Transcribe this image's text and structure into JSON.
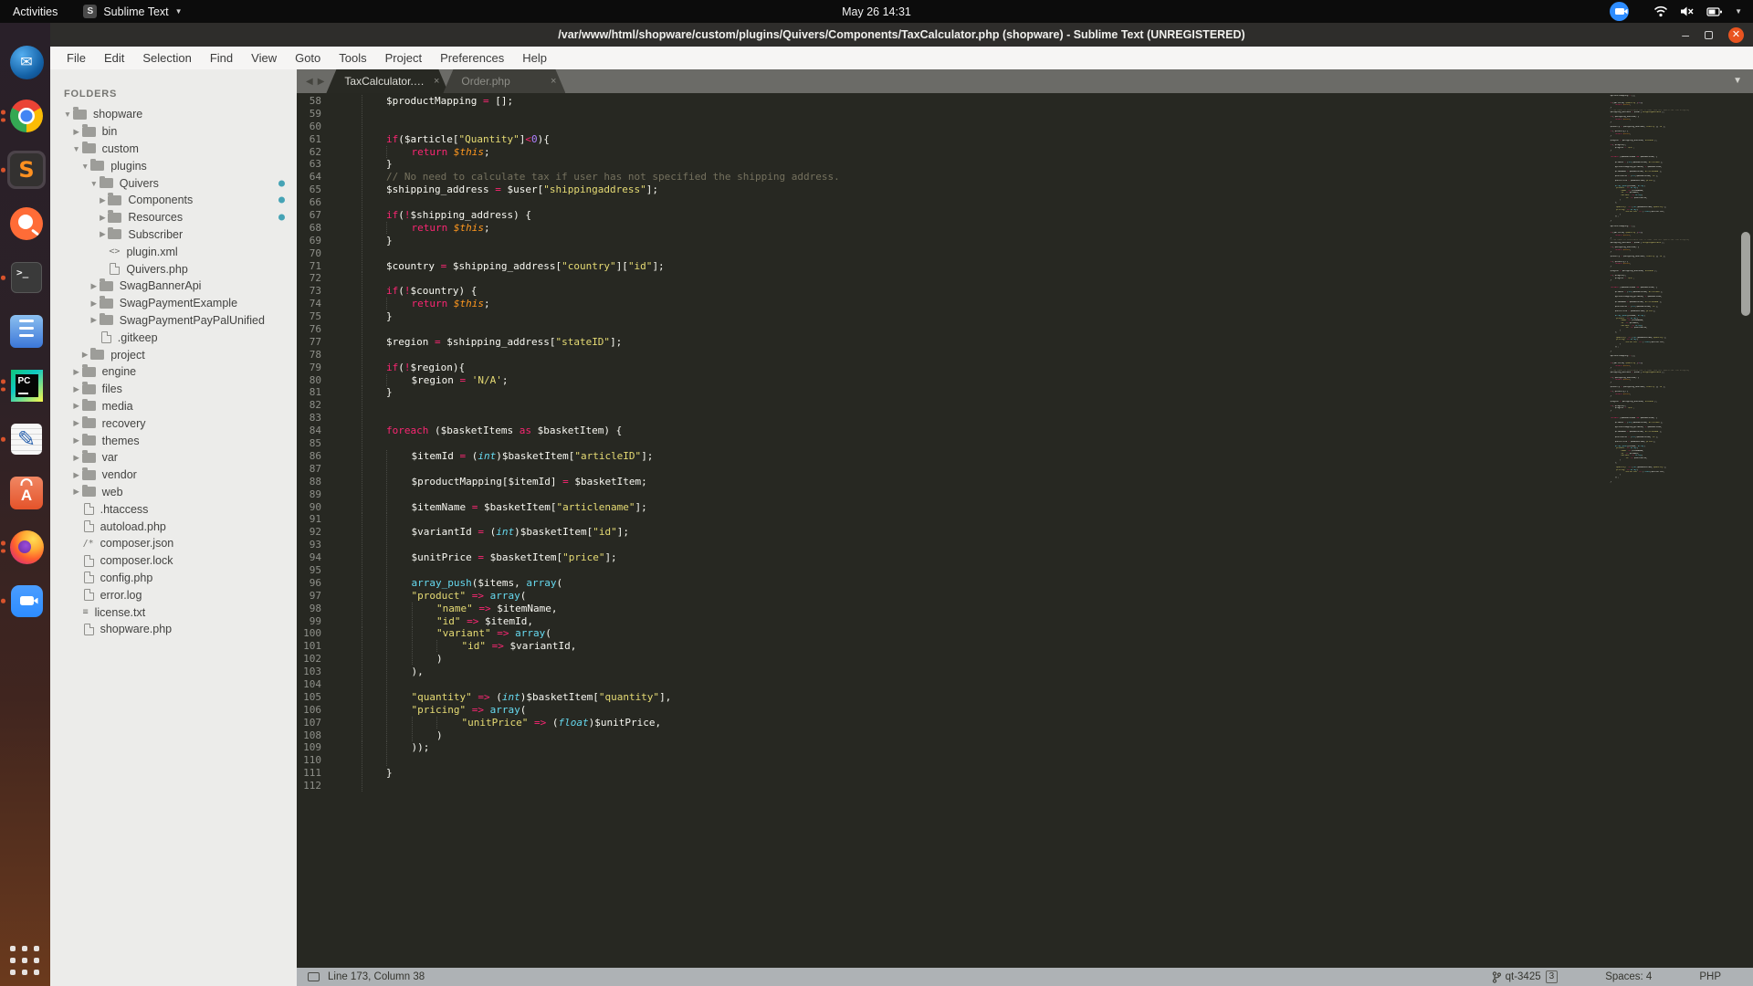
{
  "top_bar": {
    "activities": "Activities",
    "app_name": "Sublime Text",
    "clock": "May 26 14:31"
  },
  "window": {
    "title": "/var/www/html/shopware/custom/plugins/Quivers/Components/TaxCalculator.php (shopware) - Sublime Text (UNREGISTERED)"
  },
  "menu_bar": {
    "items": [
      "File",
      "Edit",
      "Selection",
      "Find",
      "View",
      "Goto",
      "Tools",
      "Project",
      "Preferences",
      "Help"
    ]
  },
  "sidebar": {
    "header": "FOLDERS",
    "tree": [
      {
        "indent": 0,
        "arrow": "open",
        "icon": "folder",
        "label": "shopware"
      },
      {
        "indent": 1,
        "arrow": "closed",
        "icon": "folder",
        "label": "bin"
      },
      {
        "indent": 1,
        "arrow": "open",
        "icon": "folder",
        "label": "custom"
      },
      {
        "indent": 2,
        "arrow": "open",
        "icon": "folder",
        "label": "plugins"
      },
      {
        "indent": 3,
        "arrow": "open",
        "icon": "folder",
        "label": "Quivers",
        "badge": true
      },
      {
        "indent": 4,
        "arrow": "closed",
        "icon": "folder",
        "label": "Components",
        "badge": true
      },
      {
        "indent": 4,
        "arrow": "closed",
        "icon": "folder",
        "label": "Resources",
        "badge": true
      },
      {
        "indent": 4,
        "arrow": "closed",
        "icon": "folder",
        "label": "Subscriber"
      },
      {
        "indent": 4,
        "icon": "xml",
        "label": "plugin.xml"
      },
      {
        "indent": 4,
        "icon": "file",
        "label": "Quivers.php"
      },
      {
        "indent": 3,
        "arrow": "closed",
        "icon": "folder",
        "label": "SwagBannerApi"
      },
      {
        "indent": 3,
        "arrow": "closed",
        "icon": "folder",
        "label": "SwagPaymentExample"
      },
      {
        "indent": 3,
        "arrow": "closed",
        "icon": "folder",
        "label": "SwagPaymentPayPalUnified"
      },
      {
        "indent": 3,
        "icon": "file",
        "label": ".gitkeep"
      },
      {
        "indent": 2,
        "arrow": "closed",
        "icon": "folder",
        "label": "project"
      },
      {
        "indent": 1,
        "arrow": "closed",
        "icon": "folder",
        "label": "engine"
      },
      {
        "indent": 1,
        "arrow": "closed",
        "icon": "folder",
        "label": "files"
      },
      {
        "indent": 1,
        "arrow": "closed",
        "icon": "folder",
        "label": "media"
      },
      {
        "indent": 1,
        "arrow": "closed",
        "icon": "folder",
        "label": "recovery"
      },
      {
        "indent": 1,
        "arrow": "closed",
        "icon": "folder",
        "label": "themes"
      },
      {
        "indent": 1,
        "arrow": "closed",
        "icon": "folder",
        "label": "var"
      },
      {
        "indent": 1,
        "arrow": "closed",
        "icon": "folder",
        "label": "vendor"
      },
      {
        "indent": 1,
        "arrow": "closed",
        "icon": "folder",
        "label": "web"
      },
      {
        "indent": 1,
        "icon": "file",
        "label": ".htaccess"
      },
      {
        "indent": 1,
        "icon": "file",
        "label": "autoload.php"
      },
      {
        "indent": 1,
        "icon": "json",
        "label": "composer.json"
      },
      {
        "indent": 1,
        "icon": "file",
        "label": "composer.lock"
      },
      {
        "indent": 1,
        "icon": "file",
        "label": "config.php"
      },
      {
        "indent": 1,
        "icon": "file",
        "label": "error.log"
      },
      {
        "indent": 1,
        "icon": "text",
        "label": "license.txt"
      },
      {
        "indent": 1,
        "icon": "file",
        "label": "shopware.php"
      }
    ]
  },
  "tabs": [
    {
      "label": "TaxCalculator.php",
      "active": true
    },
    {
      "label": "Order.php",
      "active": false
    }
  ],
  "editor": {
    "first_line": 58,
    "lines": [
      [
        [
          "p",
          "        $productMapping "
        ],
        [
          "k",
          "="
        ],
        [
          "p",
          " [];"
        ]
      ],
      [],
      [],
      [
        [
          "p",
          "        "
        ],
        [
          "k",
          "if"
        ],
        [
          "p",
          "($article["
        ],
        [
          "s",
          "\"Quantity\""
        ],
        [
          "p",
          "]"
        ],
        [
          "k",
          "<"
        ],
        [
          "n",
          "0"
        ],
        [
          "p",
          "){"
        ]
      ],
      [
        [
          "p",
          "            "
        ],
        [
          "k",
          "return"
        ],
        [
          "p",
          " "
        ],
        [
          "t",
          "$this"
        ],
        [
          "p",
          ";"
        ]
      ],
      [
        [
          "p",
          "        }"
        ]
      ],
      [
        [
          "c",
          "        // No need to calculate tax if user has not specified the shipping address."
        ]
      ],
      [
        [
          "p",
          "        $shipping_address "
        ],
        [
          "k",
          "="
        ],
        [
          "p",
          " $user["
        ],
        [
          "s",
          "\"shippingaddress\""
        ],
        [
          "p",
          "];"
        ]
      ],
      [],
      [
        [
          "p",
          "        "
        ],
        [
          "k",
          "if"
        ],
        [
          "p",
          "("
        ],
        [
          "k",
          "!"
        ],
        [
          "p",
          "$shipping_address) {"
        ]
      ],
      [
        [
          "p",
          "            "
        ],
        [
          "k",
          "return"
        ],
        [
          "p",
          " "
        ],
        [
          "t",
          "$this"
        ],
        [
          "p",
          ";"
        ]
      ],
      [
        [
          "p",
          "        }"
        ]
      ],
      [],
      [
        [
          "p",
          "        $country "
        ],
        [
          "k",
          "="
        ],
        [
          "p",
          " $shipping_address["
        ],
        [
          "s",
          "\"country\""
        ],
        [
          "p",
          "]["
        ],
        [
          "s",
          "\"id\""
        ],
        [
          "p",
          "];"
        ]
      ],
      [],
      [
        [
          "p",
          "        "
        ],
        [
          "k",
          "if"
        ],
        [
          "p",
          "("
        ],
        [
          "k",
          "!"
        ],
        [
          "p",
          "$country) {"
        ]
      ],
      [
        [
          "p",
          "            "
        ],
        [
          "k",
          "return"
        ],
        [
          "p",
          " "
        ],
        [
          "t",
          "$this"
        ],
        [
          "p",
          ";"
        ]
      ],
      [
        [
          "p",
          "        }"
        ]
      ],
      [],
      [
        [
          "p",
          "        $region "
        ],
        [
          "k",
          "="
        ],
        [
          "p",
          " $shipping_address["
        ],
        [
          "s",
          "\"stateID\""
        ],
        [
          "p",
          "];"
        ]
      ],
      [],
      [
        [
          "p",
          "        "
        ],
        [
          "k",
          "if"
        ],
        [
          "p",
          "("
        ],
        [
          "k",
          "!"
        ],
        [
          "p",
          "$region){"
        ]
      ],
      [
        [
          "p",
          "            $region "
        ],
        [
          "k",
          "="
        ],
        [
          "p",
          " "
        ],
        [
          "s",
          "'N/A'"
        ],
        [
          "p",
          ";"
        ]
      ],
      [
        [
          "p",
          "        }"
        ]
      ],
      [],
      [],
      [
        [
          "p",
          "        "
        ],
        [
          "k",
          "foreach"
        ],
        [
          "p",
          " ($basketItems "
        ],
        [
          "k",
          "as"
        ],
        [
          "p",
          " $basketItem) {"
        ]
      ],
      [],
      [
        [
          "p",
          "            $itemId "
        ],
        [
          "k",
          "="
        ],
        [
          "p",
          " ("
        ],
        [
          "i",
          "int"
        ],
        [
          "p",
          ")$basketItem["
        ],
        [
          "s",
          "\"articleID\""
        ],
        [
          "p",
          "];"
        ]
      ],
      [],
      [
        [
          "p",
          "            $productMapping[$itemId] "
        ],
        [
          "k",
          "="
        ],
        [
          "p",
          " $basketItem;"
        ]
      ],
      [],
      [
        [
          "p",
          "            $itemName "
        ],
        [
          "k",
          "="
        ],
        [
          "p",
          " $basketItem["
        ],
        [
          "s",
          "\"articlename\""
        ],
        [
          "p",
          "];"
        ]
      ],
      [],
      [
        [
          "p",
          "            $variantId "
        ],
        [
          "k",
          "="
        ],
        [
          "p",
          " ("
        ],
        [
          "i",
          "int"
        ],
        [
          "p",
          ")$basketItem["
        ],
        [
          "s",
          "\"id\""
        ],
        [
          "p",
          "];"
        ]
      ],
      [],
      [
        [
          "p",
          "            $unitPrice "
        ],
        [
          "k",
          "="
        ],
        [
          "p",
          " $basketItem["
        ],
        [
          "s",
          "\"price\""
        ],
        [
          "p",
          "];"
        ]
      ],
      [],
      [
        [
          "p",
          "            "
        ],
        [
          "f",
          "array_push"
        ],
        [
          "p",
          "($items, "
        ],
        [
          "f",
          "array"
        ],
        [
          "p",
          "("
        ]
      ],
      [
        [
          "p",
          "            "
        ],
        [
          "s",
          "\"product\""
        ],
        [
          "p",
          " "
        ],
        [
          "k",
          "=>"
        ],
        [
          "p",
          " "
        ],
        [
          "f",
          "array"
        ],
        [
          "p",
          "("
        ]
      ],
      [
        [
          "p",
          "                "
        ],
        [
          "s",
          "\"name\""
        ],
        [
          "p",
          " "
        ],
        [
          "k",
          "=>"
        ],
        [
          "p",
          " $itemName,"
        ]
      ],
      [
        [
          "p",
          "                "
        ],
        [
          "s",
          "\"id\""
        ],
        [
          "p",
          " "
        ],
        [
          "k",
          "=>"
        ],
        [
          "p",
          " $itemId,"
        ]
      ],
      [
        [
          "p",
          "                "
        ],
        [
          "s",
          "\"variant\""
        ],
        [
          "p",
          " "
        ],
        [
          "k",
          "=>"
        ],
        [
          "p",
          " "
        ],
        [
          "f",
          "array"
        ],
        [
          "p",
          "("
        ]
      ],
      [
        [
          "p",
          "                    "
        ],
        [
          "s",
          "\"id\""
        ],
        [
          "p",
          " "
        ],
        [
          "k",
          "=>"
        ],
        [
          "p",
          " $variantId,"
        ]
      ],
      [
        [
          "p",
          "                )"
        ]
      ],
      [
        [
          "p",
          "            ),"
        ]
      ],
      [],
      [
        [
          "p",
          "            "
        ],
        [
          "s",
          "\"quantity\""
        ],
        [
          "p",
          " "
        ],
        [
          "k",
          "=>"
        ],
        [
          "p",
          " ("
        ],
        [
          "i",
          "int"
        ],
        [
          "p",
          ")$basketItem["
        ],
        [
          "s",
          "\"quantity\""
        ],
        [
          "p",
          "],"
        ]
      ],
      [
        [
          "p",
          "            "
        ],
        [
          "s",
          "\"pricing\""
        ],
        [
          "p",
          " "
        ],
        [
          "k",
          "=>"
        ],
        [
          "p",
          " "
        ],
        [
          "f",
          "array"
        ],
        [
          "p",
          "("
        ]
      ],
      [
        [
          "p",
          "                    "
        ],
        [
          "s",
          "\"unitPrice\""
        ],
        [
          "p",
          " "
        ],
        [
          "k",
          "=>"
        ],
        [
          "p",
          " ("
        ],
        [
          "i",
          "float"
        ],
        [
          "p",
          ")$unitPrice,"
        ]
      ],
      [
        [
          "p",
          "                )"
        ]
      ],
      [
        [
          "p",
          "            ));"
        ]
      ],
      [],
      [
        [
          "p",
          "        }"
        ]
      ],
      []
    ]
  },
  "status_bar": {
    "position": "Line 173, Column 38",
    "branch": "qt-3425",
    "branch_count": "3",
    "spaces": "Spaces: 4",
    "syntax": "PHP"
  },
  "dock": {
    "apps": [
      {
        "id": "thunderbird",
        "dots": 0
      },
      {
        "id": "chrome",
        "dots": 2
      },
      {
        "id": "sublime",
        "dots": 1,
        "active": true
      },
      {
        "id": "postman",
        "dots": 0
      },
      {
        "id": "terminal",
        "dots": 1
      },
      {
        "id": "files",
        "dots": 0
      },
      {
        "id": "pycharm",
        "dots": 2
      },
      {
        "id": "gedit",
        "dots": 1
      },
      {
        "id": "software",
        "dots": 0
      },
      {
        "id": "firefox",
        "dots": 2
      },
      {
        "id": "zoom",
        "dots": 1
      }
    ]
  },
  "colors": {
    "editor_bg": "#272822",
    "keyword": "#f92672",
    "string": "#e6db74",
    "number": "#ae81ff",
    "function": "#66d9ef",
    "this_var": "#fd971f",
    "comment": "#75715e",
    "badge_teal": "#45a3b5",
    "dock_dot": "#d9532c",
    "close_button": "#e95420",
    "zoom_blue": "#2d8cff"
  }
}
